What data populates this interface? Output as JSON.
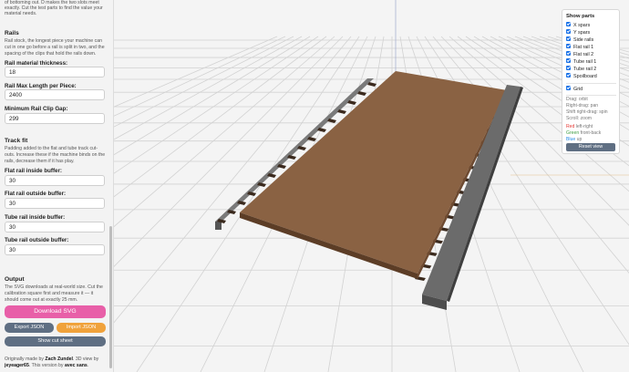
{
  "sidebar": {
    "intro": {
      "line1": "of bottoming out. D makes the two slots meet",
      "line2": "exactly. Cut the test parts to find the value your",
      "line3": "material needs."
    },
    "rails": {
      "heading": "Rails",
      "desc1": "Rail stock, the longest piece your machine can",
      "desc2": "cut in one go before a rail is split in two, and the",
      "desc3": "spacing of the clips that hold the rails down.",
      "thickness_label": "Rail material thickness:",
      "thickness_value": "18",
      "max_length_label": "Rail Max Length per Piece:",
      "max_length_value": "2400",
      "clip_gap_label": "Minimum Rail Clip Gap:",
      "clip_gap_value": "299"
    },
    "track": {
      "heading": "Track fit",
      "desc1": "Padding added to the flat and tube track cut-",
      "desc2": "outs. Increase these if the machine binds on the",
      "desc3": "rails, decrease them if it has play.",
      "flat_in_label": "Flat rail inside buffer:",
      "flat_in_value": "30",
      "flat_out_label": "Flat rail outside buffer:",
      "flat_out_value": "30",
      "tube_in_label": "Tube rail inside buffer:",
      "tube_in_value": "30",
      "tube_out_label": "Tube rail outside buffer:",
      "tube_out_value": "30"
    },
    "output": {
      "heading": "Output",
      "desc1": "The SVG downloads at real-world size. Cut the",
      "desc2": "calibration square first and measure it — it",
      "desc3": "should come out at exactly 25 mm.",
      "download_label": "Download SVG",
      "export_label": "Export JSON",
      "import_label": "Import JSON",
      "cutsheet_label": "Show cut sheet"
    },
    "credits": {
      "pre": "Originally made by ",
      "author": "Zach Zundel",
      "mid": ". 3D view by",
      "author2": "jeyeager65",
      "mid2": ". This version by ",
      "author3": "avec sans",
      "end": "."
    }
  },
  "panel": {
    "title": "Show parts",
    "items": [
      "X spars",
      "Y spars",
      "Side rails",
      "Flat rail 1",
      "Flat rail 2",
      "Tube rail 1",
      "Tube rail 2",
      "Spoilboard"
    ],
    "grid_label": "Grid",
    "help": [
      "Drag: orbit",
      "Right-drag: pan",
      "Shift right-drag: spin",
      "Scroll: zoom"
    ],
    "axes": [
      {
        "color_word": "Red",
        "rest": " left-right",
        "color": "#e53935"
      },
      {
        "color_word": "Green",
        "rest": " front-back",
        "color": "#43a047"
      },
      {
        "color_word": "Blue",
        "rest": " up",
        "color": "#1e88e5"
      }
    ],
    "reset_label": "Reset view"
  },
  "colors": {
    "pink_button": "#e85fa8",
    "gray_button": "#5f6f83",
    "orange_button": "#f0a23b",
    "spoilboard": "#8a6243",
    "rail": "#6b6b6b"
  }
}
